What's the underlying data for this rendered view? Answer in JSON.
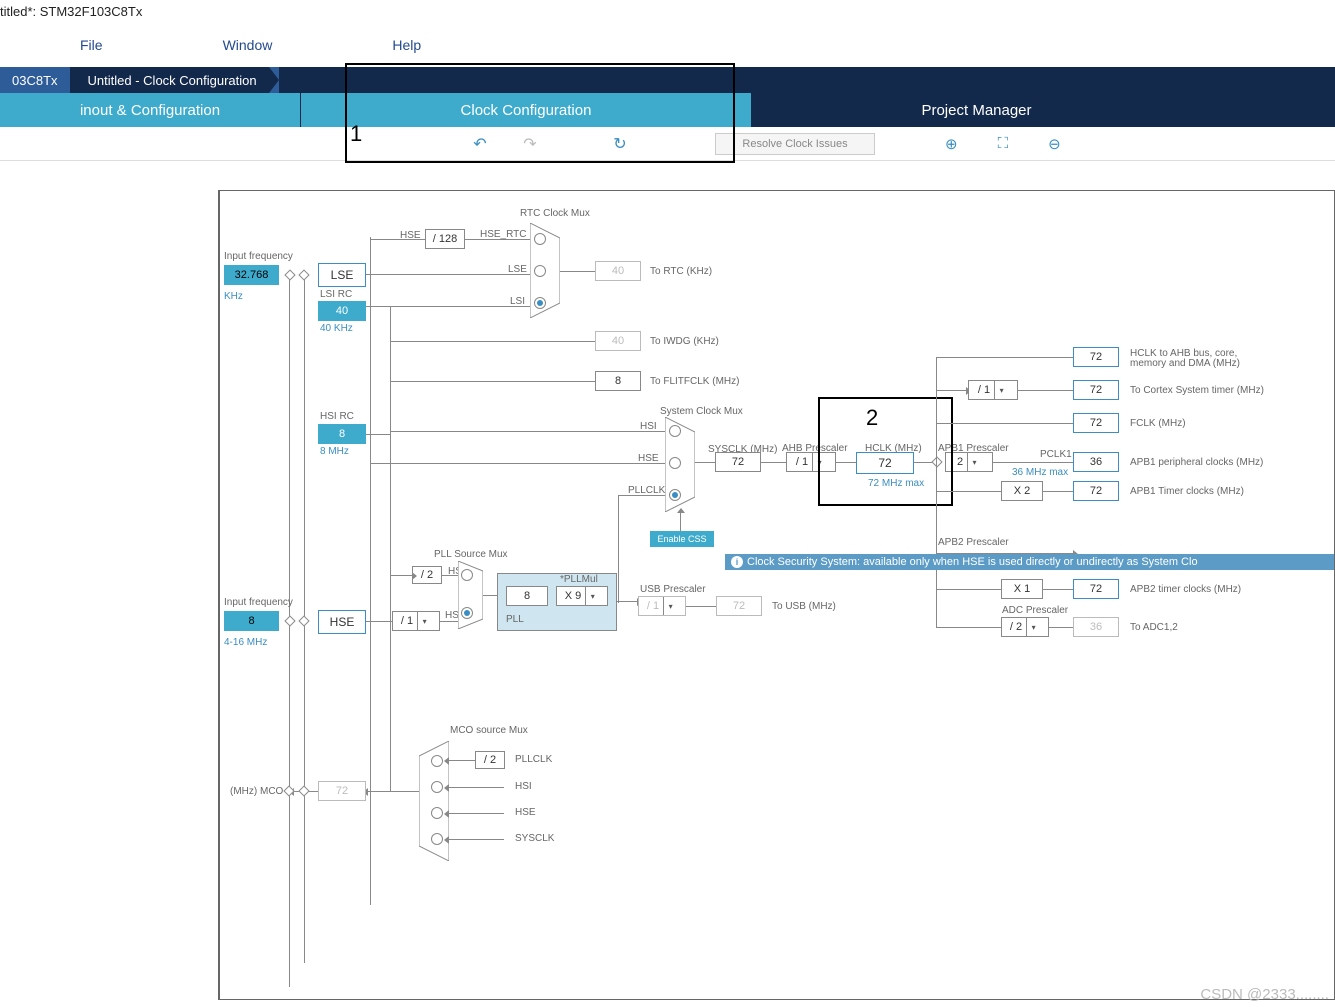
{
  "titlebar": "titled*: STM32F103C8Tx",
  "menu": {
    "file": "File",
    "window": "Window",
    "help": "Help"
  },
  "breadcrumb": {
    "chip": "03C8Tx",
    "page": "Untitled - Clock Configuration"
  },
  "tabs": {
    "pinout": "inout & Configuration",
    "clock": "Clock Configuration",
    "project": "Project Manager"
  },
  "toolbar": {
    "resolve": "Resolve Clock Issues"
  },
  "annotations": {
    "one": "1",
    "two": "2"
  },
  "watermark": "CSDN @2333........",
  "tooltip": "Clock Security System: available only when HSE is used directly or undirectly as System Clo",
  "diagram": {
    "rtc_mux": "RTC Clock Mux",
    "input_freq_top": "Input frequency",
    "lse_val": "32.768",
    "lse_unit": "KHz",
    "lse_name": "LSE",
    "lsi_name": "LSI RC",
    "lsi_val": "40",
    "lsi_unit": "40 KHz",
    "hse_div": "/ 128",
    "hse_lbl": "HSE",
    "hse_rtc": "HSE_RTC",
    "lse_lbl": "LSE",
    "lsi_lbl": "LSI",
    "to_rtc_val": "40",
    "to_rtc": "To RTC (KHz)",
    "to_iwdg_val": "40",
    "to_iwdg": "To IWDG (KHz)",
    "flitfclk_val": "8",
    "flitfclk": "To FLITFCLK (MHz)",
    "hsi_name": "HSI RC",
    "hsi_val": "8",
    "hsi_unit": "8 MHz",
    "sysclk_mux": "System Clock Mux",
    "hsi_lbl": "HSI",
    "hse_lbl2": "HSE",
    "pllclk_lbl": "PLLCLK",
    "enable_css": "Enable CSS",
    "sysclk": "SYSCLK (MHz)",
    "sysclk_val": "72",
    "ahb_pre": "AHB Prescaler",
    "ahb_pre_val": "/ 1",
    "hclk": "HCLK (MHz)",
    "hclk_val": "72",
    "hclk_max": "72 MHz max",
    "apb1_pre": "APB1 Prescaler",
    "apb1_pre_val": "2",
    "pclk1": "PCLK1",
    "pclk1_max": "36 MHz max",
    "cortex_pre_val": "/ 1",
    "out_ahb_val": "72",
    "out_ahb": "HCLK to AHB bus, core, memory and DMA (MHz)",
    "out_cortex_val": "72",
    "out_cortex": "To Cortex System timer (MHz)",
    "out_fclk_val": "72",
    "out_fclk": "FCLK (MHz)",
    "out_apb1p_val": "36",
    "out_apb1p": "APB1 peripheral clocks (MHz)",
    "out_apb1t_val": "72",
    "out_apb1t": "APB1 Timer clocks (MHz)",
    "apb1t_mul": "X 2",
    "apb2_pre": "APB2 Prescaler",
    "apb2t_mul": "X 1",
    "out_apb2t_val": "72",
    "out_apb2t": "APB2 timer clocks (MHz)",
    "adc_pre": "ADC Prescaler",
    "adc_pre_val": "/ 2",
    "out_adc_val": "36",
    "out_adc": "To ADC1,2",
    "input_freq_bot": "Input frequency",
    "hse_val": "8",
    "hse_unit": "4-16 MHz",
    "hse_name": "HSE",
    "hse_pre_val": "/ 1",
    "pll_mux": "PLL Source Mux",
    "pll_hsi": "HSI",
    "pll_hse": "HSE",
    "hsi_div2": "/ 2",
    "pll_val": "8",
    "pll_mul_lbl": "*PLLMul",
    "pll_mul": "X 9",
    "pll_name": "PLL",
    "usb_pre": "USB Prescaler",
    "usb_pre_val": "/ 1",
    "usb_val": "72",
    "usb_lbl": "To USB (MHz)",
    "mco_mux": "MCO source Mux",
    "mco_pll_div": "/ 2",
    "mco_pllclk": "PLLCLK",
    "mco_hsi": "HSI",
    "mco_hse": "HSE",
    "mco_sys": "SYSCLK",
    "mco_val": "72",
    "mco_lbl": "(MHz) MCO"
  }
}
